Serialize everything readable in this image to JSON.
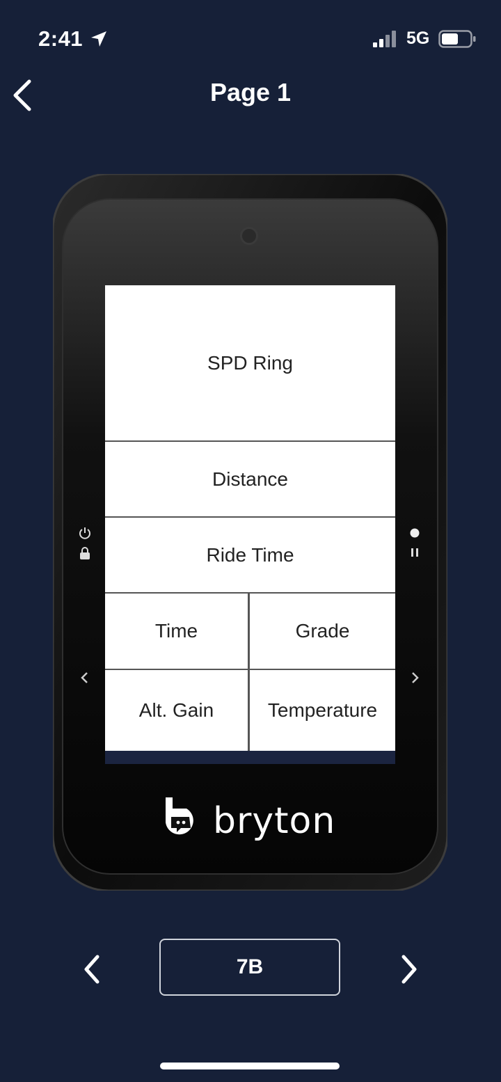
{
  "status_bar": {
    "time": "2:41",
    "network": "5G",
    "icons": [
      "location-arrow-icon",
      "signal-icon",
      "battery-icon"
    ]
  },
  "nav": {
    "title": "Page 1",
    "back_icon": "chevron-left-icon"
  },
  "device": {
    "brand": "bryton",
    "fields": {
      "top": "SPD Ring",
      "row2": "Distance",
      "row3": "Ride Time",
      "row4_left": "Time",
      "row4_right": "Grade",
      "row5_left": "Alt. Gain",
      "row5_right": "Temperature"
    },
    "side_icons": [
      "power-icon",
      "lock-icon",
      "record-icon",
      "pause-icon",
      "left-arrow-icon",
      "right-arrow-icon"
    ]
  },
  "layout_selector": {
    "value": "7B",
    "prev_icon": "chevron-left-icon",
    "next_icon": "chevron-right-icon"
  },
  "colors": {
    "background": "#162038",
    "device_body": "#111111",
    "screen": "#ffffff"
  }
}
